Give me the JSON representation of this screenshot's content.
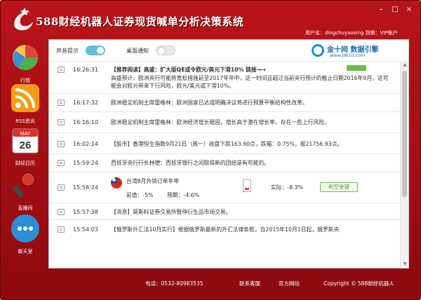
{
  "window": {
    "title": "588财经机器人证券现货喊单分析决策系统",
    "user_info": "用户名：dingchuyaoxing  到期：VIP账户",
    "controls": {
      "minimize": "–",
      "maximize": "□",
      "close": "×"
    }
  },
  "sidebar": {
    "items": [
      {
        "label": "行情",
        "icon": "pie-chart-icon"
      },
      {
        "label": "RSS资讯",
        "icon": "rss-icon"
      },
      {
        "label": "财经日历",
        "icon": "calendar-icon"
      },
      {
        "label": "直播间",
        "icon": "microphone-icon"
      },
      {
        "label": "聊天室",
        "icon": "chat-icon"
      }
    ],
    "calendar_day": "26",
    "calendar_month": "MAY"
  },
  "toolbar": {
    "sound_label": "声音提示",
    "sound_on": true,
    "desktop_label": "桌面通知",
    "desktop_on": false,
    "brand_name": "金十网 数据引擎",
    "brand_url": "www.JIN10.com"
  },
  "feed": [
    {
      "time": "16:26:31",
      "title": "【推荐阅读】高盛：扩大版QE或令欧元/美元下滑10% 链接→→",
      "body": "高盛预计，欧洲央行可能将宽松措施延至2017年年中，这一时间远超过当前央行预计的截止日期2016年9月，这可能会对欧元带来下行风险，欧元/美元或下滑10%。"
    },
    {
      "time": "16:17:32",
      "text": "欧洲稳定机制主席雷格林：欧洲国家已达成明确决议将进行预算平衡结构性改革。"
    },
    {
      "time": "16:16:10",
      "text": "欧洲稳定机制主席雷格林：欧洲经济增长稳固，增长高于潜在增长率，存在一些上行风险。"
    },
    {
      "time": "16:02:14",
      "text": "【股市】香港恒生指数9月21日（周一）收盘下跌163.90点，跌幅：0.75%，报21756.93点。"
    },
    {
      "time": "15:59:24",
      "text": "西班牙央行行长林德：西班牙银行之间取得新的团结是有可能的。"
    },
    {
      "time": "15:58:24",
      "indicator": "台湾8月外销订单年率",
      "previous": "前值：-5%",
      "forecast": "预期：-4.6%",
      "actual": "实际：-8.3%",
      "effect": "利空金银"
    },
    {
      "time": "15:57:38",
      "text": "【消息】莫斯科证券交易所暂停衍生品市场交易。"
    },
    {
      "time": "15:54:03",
      "text": "【俄罗斯外汇法10月实行】根据俄罗斯最新的外汇法律条款，自2015年10月1日起，俄罗斯央"
    }
  ],
  "footer": {
    "phone": "电话：0532-80983535",
    "contact": "联系客服",
    "website": "官方网站",
    "copyright": "Copyright © 588财经机器人"
  },
  "colors": {
    "frame": "#a00e12",
    "toggle_on": "#5bc2d8",
    "effect_green": "#6abf4b",
    "brand_blue": "#1a6fc0"
  }
}
